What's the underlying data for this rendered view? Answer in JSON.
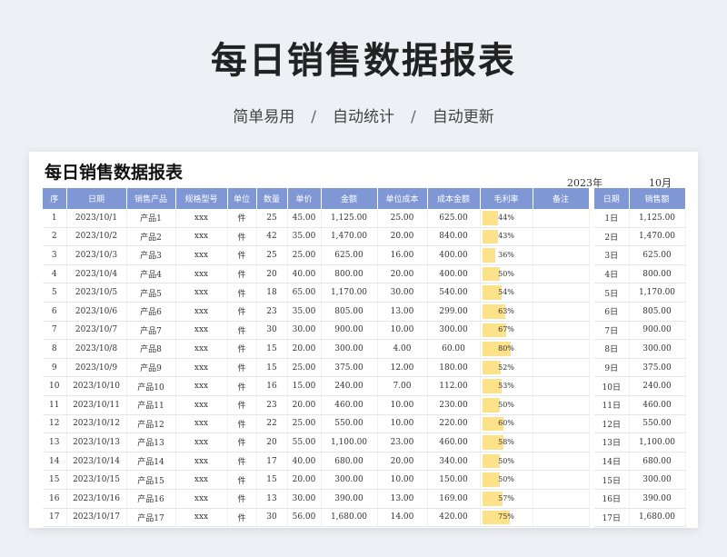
{
  "header": {
    "title": "每日销售数据报表",
    "subtitle_items": [
      "简单易用",
      "自动统计",
      "自动更新"
    ],
    "separator": "/"
  },
  "sheet": {
    "title": "每日销售数据报表",
    "year": "2023年",
    "month": "10月",
    "columns": [
      "序",
      "日期",
      "销售产品",
      "规格型号",
      "单位",
      "数量",
      "单价",
      "金额",
      "单位成本",
      "成本金额",
      "毛利率",
      "备注"
    ],
    "rows": [
      {
        "idx": "1",
        "date": "2023/10/1",
        "product": "产品1",
        "spec": "xxx",
        "unit": "件",
        "qty": "25",
        "price": "45.00",
        "amount": "1,125.00",
        "unit_cost": "25.00",
        "cost_amount": "625.00",
        "margin": "44%",
        "margin_value": 0.44,
        "note": ""
      },
      {
        "idx": "2",
        "date": "2023/10/2",
        "product": "产品2",
        "spec": "xxx",
        "unit": "件",
        "qty": "42",
        "price": "35.00",
        "amount": "1,470.00",
        "unit_cost": "20.00",
        "cost_amount": "840.00",
        "margin": "43%",
        "margin_value": 0.43,
        "note": ""
      },
      {
        "idx": "3",
        "date": "2023/10/3",
        "product": "产品3",
        "spec": "xxx",
        "unit": "件",
        "qty": "25",
        "price": "25.00",
        "amount": "625.00",
        "unit_cost": "16.00",
        "cost_amount": "400.00",
        "margin": "36%",
        "margin_value": 0.36,
        "note": ""
      },
      {
        "idx": "4",
        "date": "2023/10/4",
        "product": "产品4",
        "spec": "xxx",
        "unit": "件",
        "qty": "20",
        "price": "40.00",
        "amount": "800.00",
        "unit_cost": "20.00",
        "cost_amount": "400.00",
        "margin": "50%",
        "margin_value": 0.5,
        "note": ""
      },
      {
        "idx": "5",
        "date": "2023/10/5",
        "product": "产品5",
        "spec": "xxx",
        "unit": "件",
        "qty": "18",
        "price": "65.00",
        "amount": "1,170.00",
        "unit_cost": "30.00",
        "cost_amount": "540.00",
        "margin": "54%",
        "margin_value": 0.54,
        "note": ""
      },
      {
        "idx": "6",
        "date": "2023/10/6",
        "product": "产品6",
        "spec": "xxx",
        "unit": "件",
        "qty": "23",
        "price": "35.00",
        "amount": "805.00",
        "unit_cost": "13.00",
        "cost_amount": "299.00",
        "margin": "63%",
        "margin_value": 0.63,
        "note": ""
      },
      {
        "idx": "7",
        "date": "2023/10/7",
        "product": "产品7",
        "spec": "xxx",
        "unit": "件",
        "qty": "30",
        "price": "30.00",
        "amount": "900.00",
        "unit_cost": "10.00",
        "cost_amount": "300.00",
        "margin": "67%",
        "margin_value": 0.67,
        "note": ""
      },
      {
        "idx": "8",
        "date": "2023/10/8",
        "product": "产品8",
        "spec": "xxx",
        "unit": "件",
        "qty": "15",
        "price": "20.00",
        "amount": "300.00",
        "unit_cost": "4.00",
        "cost_amount": "60.00",
        "margin": "80%",
        "margin_value": 0.8,
        "note": ""
      },
      {
        "idx": "9",
        "date": "2023/10/9",
        "product": "产品9",
        "spec": "xxx",
        "unit": "件",
        "qty": "15",
        "price": "25.00",
        "amount": "375.00",
        "unit_cost": "12.00",
        "cost_amount": "180.00",
        "margin": "52%",
        "margin_value": 0.52,
        "note": ""
      },
      {
        "idx": "10",
        "date": "2023/10/10",
        "product": "产品10",
        "spec": "xxx",
        "unit": "件",
        "qty": "16",
        "price": "15.00",
        "amount": "240.00",
        "unit_cost": "7.00",
        "cost_amount": "112.00",
        "margin": "53%",
        "margin_value": 0.53,
        "note": ""
      },
      {
        "idx": "11",
        "date": "2023/10/11",
        "product": "产品11",
        "spec": "xxx",
        "unit": "件",
        "qty": "23",
        "price": "20.00",
        "amount": "460.00",
        "unit_cost": "10.00",
        "cost_amount": "230.00",
        "margin": "50%",
        "margin_value": 0.5,
        "note": ""
      },
      {
        "idx": "12",
        "date": "2023/10/12",
        "product": "产品12",
        "spec": "xxx",
        "unit": "件",
        "qty": "22",
        "price": "25.00",
        "amount": "550.00",
        "unit_cost": "10.00",
        "cost_amount": "220.00",
        "margin": "60%",
        "margin_value": 0.6,
        "note": ""
      },
      {
        "idx": "13",
        "date": "2023/10/13",
        "product": "产品13",
        "spec": "xxx",
        "unit": "件",
        "qty": "20",
        "price": "55.00",
        "amount": "1,100.00",
        "unit_cost": "23.00",
        "cost_amount": "460.00",
        "margin": "58%",
        "margin_value": 0.58,
        "note": ""
      },
      {
        "idx": "14",
        "date": "2023/10/14",
        "product": "产品14",
        "spec": "xxx",
        "unit": "件",
        "qty": "17",
        "price": "40.00",
        "amount": "680.00",
        "unit_cost": "20.00",
        "cost_amount": "340.00",
        "margin": "50%",
        "margin_value": 0.5,
        "note": ""
      },
      {
        "idx": "15",
        "date": "2023/10/15",
        "product": "产品15",
        "spec": "xxx",
        "unit": "件",
        "qty": "15",
        "price": "20.00",
        "amount": "300.00",
        "unit_cost": "10.00",
        "cost_amount": "150.00",
        "margin": "50%",
        "margin_value": 0.5,
        "note": ""
      },
      {
        "idx": "16",
        "date": "2023/10/16",
        "product": "产品16",
        "spec": "xxx",
        "unit": "件",
        "qty": "13",
        "price": "30.00",
        "amount": "390.00",
        "unit_cost": "13.00",
        "cost_amount": "169.00",
        "margin": "57%",
        "margin_value": 0.57,
        "note": ""
      },
      {
        "idx": "17",
        "date": "2023/10/17",
        "product": "产品17",
        "spec": "xxx",
        "unit": "件",
        "qty": "30",
        "price": "56.00",
        "amount": "1,680.00",
        "unit_cost": "14.00",
        "cost_amount": "420.00",
        "margin": "75%",
        "margin_value": 0.75,
        "note": ""
      }
    ],
    "summary_columns": [
      "日期",
      "销售额"
    ],
    "summary_rows": [
      {
        "day": "1日",
        "sales": "1,125.00"
      },
      {
        "day": "2日",
        "sales": "1,470.00"
      },
      {
        "day": "3日",
        "sales": "625.00"
      },
      {
        "day": "4日",
        "sales": "800.00"
      },
      {
        "day": "5日",
        "sales": "1,170.00"
      },
      {
        "day": "6日",
        "sales": "805.00"
      },
      {
        "day": "7日",
        "sales": "900.00"
      },
      {
        "day": "8日",
        "sales": "300.00"
      },
      {
        "day": "9日",
        "sales": "375.00"
      },
      {
        "day": "10日",
        "sales": "240.00"
      },
      {
        "day": "11日",
        "sales": "460.00"
      },
      {
        "day": "12日",
        "sales": "550.00"
      },
      {
        "day": "13日",
        "sales": "1,100.00"
      },
      {
        "day": "14日",
        "sales": "680.00"
      },
      {
        "day": "15日",
        "sales": "300.00"
      },
      {
        "day": "16日",
        "sales": "390.00"
      },
      {
        "day": "17日",
        "sales": "1,680.00"
      }
    ]
  },
  "colors": {
    "header_bg": "#7f97d4",
    "margin_bar": "#fde28a",
    "page_bg": "#eef0f5"
  }
}
